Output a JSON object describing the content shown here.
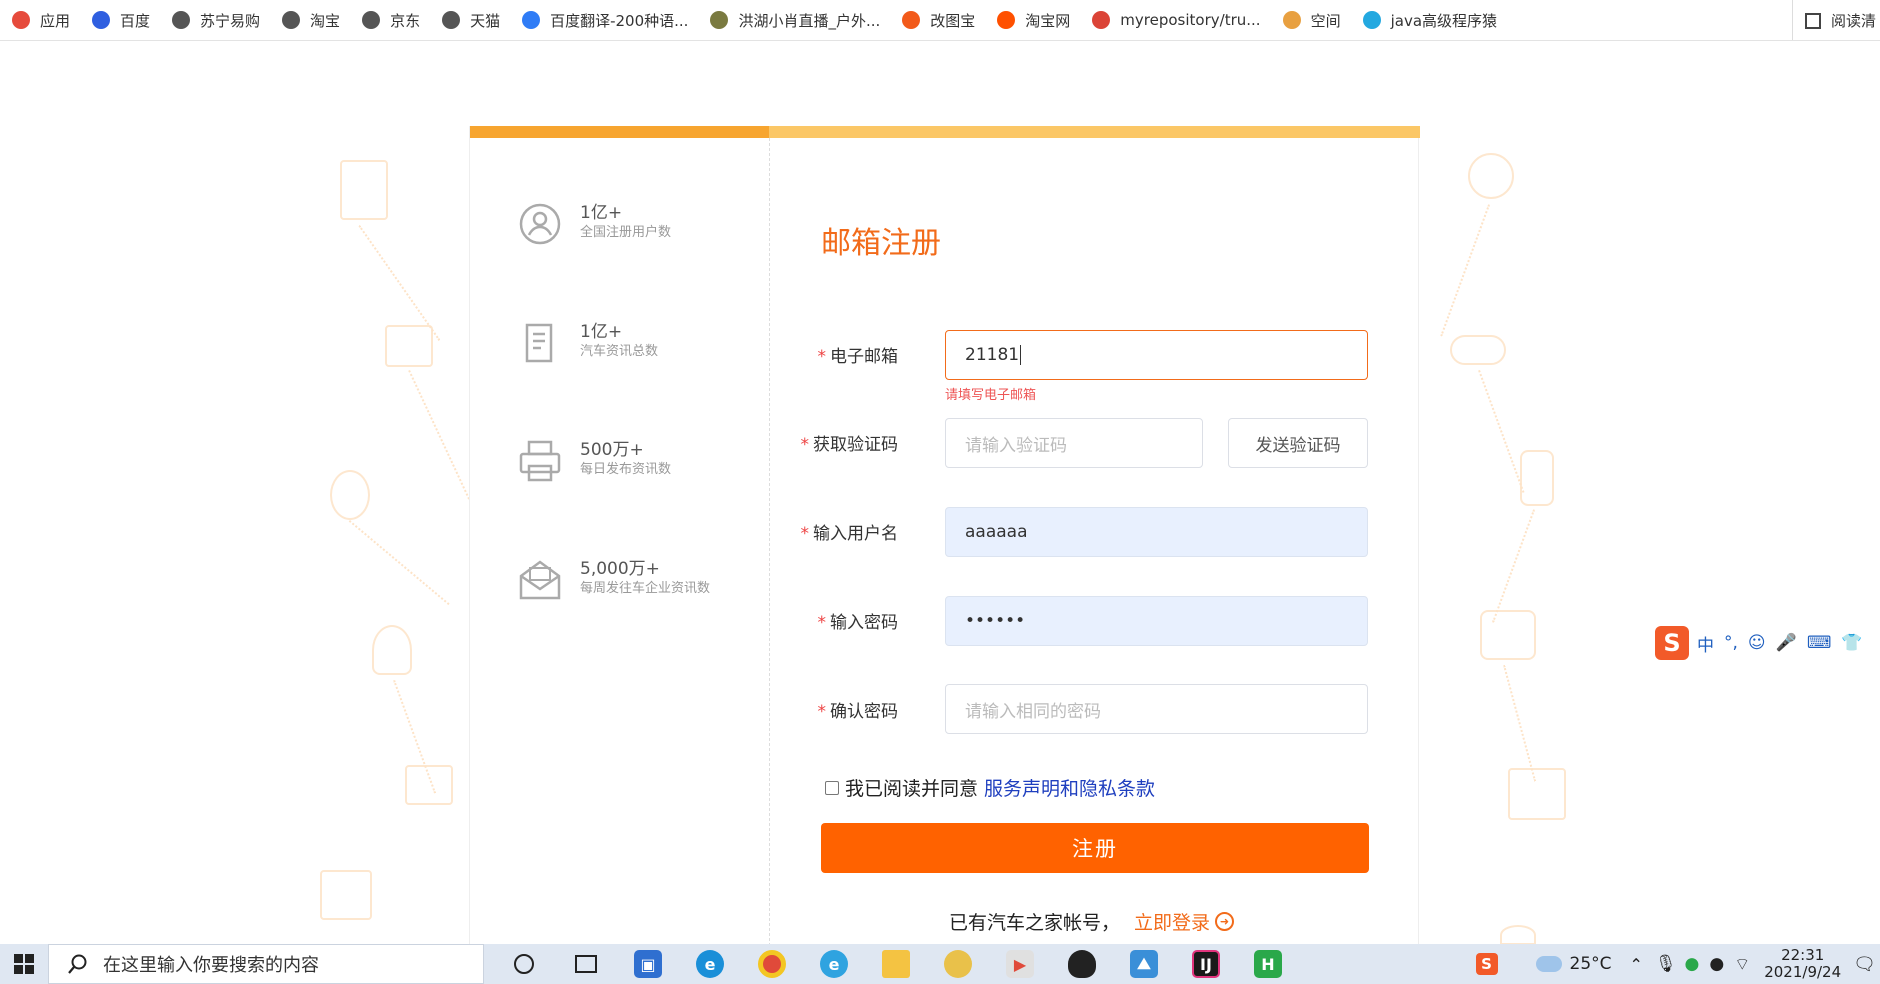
{
  "bookmarks": [
    {
      "label": "应用",
      "icon": "apps-grid-icon",
      "color": "#e64b3c"
    },
    {
      "label": "百度",
      "icon": "baidu-paw-icon",
      "color": "#2f5fe0"
    },
    {
      "label": "苏宁易购",
      "icon": "globe-icon",
      "color": "#555555"
    },
    {
      "label": "淘宝",
      "icon": "globe-icon",
      "color": "#555555"
    },
    {
      "label": "京东",
      "icon": "globe-icon",
      "color": "#555555"
    },
    {
      "label": "天猫",
      "icon": "globe-icon",
      "color": "#555555"
    },
    {
      "label": "百度翻译-200种语...",
      "icon": "baidu-translate-icon",
      "color": "#2f7cf6"
    },
    {
      "label": "洪湖小肖直播_户外...",
      "icon": "bird-icon",
      "color": "#7a7a40"
    },
    {
      "label": "改图宝",
      "icon": "gaitubao-icon",
      "color": "#f25a1a"
    },
    {
      "label": "淘宝网",
      "icon": "taobao-icon",
      "color": "#ff5000"
    },
    {
      "label": "myrepository/tru...",
      "icon": "chrome-icon",
      "color": "#db4437"
    },
    {
      "label": "空间",
      "icon": "qzone-icon",
      "color": "#e8a040"
    },
    {
      "label": "java高级程序猿",
      "icon": "bilibili-tv-icon",
      "color": "#23a8e0"
    }
  ],
  "reading_mode_label": "阅读清",
  "stats": [
    {
      "number": "1亿+",
      "desc": "全国注册用户数",
      "icon": "user-circle-icon"
    },
    {
      "number": "1亿+",
      "desc": "汽车资讯总数",
      "icon": "document-icon"
    },
    {
      "number": "500万+",
      "desc": "每日发布资讯数",
      "icon": "printer-icon"
    },
    {
      "number": "5,000万+",
      "desc": "每周发往车企业资讯数",
      "icon": "envelope-icon"
    }
  ],
  "form": {
    "title": "邮箱注册",
    "required_mark": "*",
    "email": {
      "label": "电子邮箱",
      "value": "21181",
      "error": "请填写电子邮箱"
    },
    "code": {
      "label": "获取验证码",
      "placeholder": "请输入验证码",
      "send_label": "发送验证码"
    },
    "username": {
      "label": "输入用户名",
      "value": "aaaaaa"
    },
    "password": {
      "label": "输入密码",
      "value": "••••••"
    },
    "confirm": {
      "label": "确认密码",
      "placeholder": "请输入相同的密码"
    },
    "agree_text": "我已阅读并同意",
    "agree_link": "服务声明和隐私条款",
    "submit_label": "注册",
    "login_prompt": "已有汽车之家帐号，",
    "login_link": "立即登录"
  },
  "ime": {
    "logo": "S",
    "items": [
      "中",
      "°,",
      "☺",
      "🎤",
      "⌨",
      "👕"
    ]
  },
  "taskbar": {
    "search_placeholder": "在这里输入你要搜索的内容",
    "temperature": "25°C",
    "time": "22:31",
    "date": "2021/9/24"
  }
}
